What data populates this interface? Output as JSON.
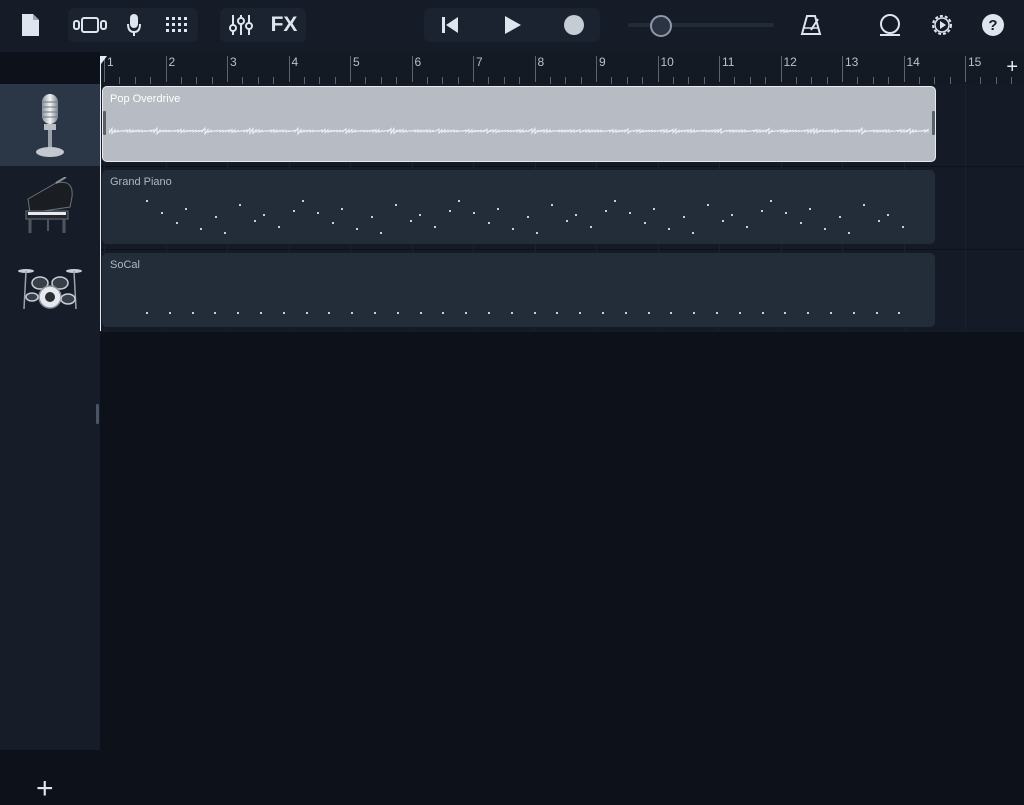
{
  "toolbar": {
    "fx_label": "FX"
  },
  "ruler": {
    "bars": [
      "1",
      "2",
      "3",
      "4",
      "5",
      "6",
      "7",
      "8",
      "9",
      "10",
      "11",
      "12",
      "13",
      "14",
      "15"
    ],
    "add_label": "+"
  },
  "tracks": [
    {
      "name": "Pop Overdrive",
      "icon": "microphone-icon",
      "type": "audio"
    },
    {
      "name": "Grand Piano",
      "icon": "grand-piano-icon",
      "type": "midi"
    },
    {
      "name": "SoCal",
      "icon": "drum-kit-icon",
      "type": "drums"
    }
  ],
  "sidebar": {
    "add_track_label": "+"
  },
  "colors": {
    "accent_region": "#b7bcc4",
    "midi_region": "#232c39",
    "background": "#0c111a"
  }
}
